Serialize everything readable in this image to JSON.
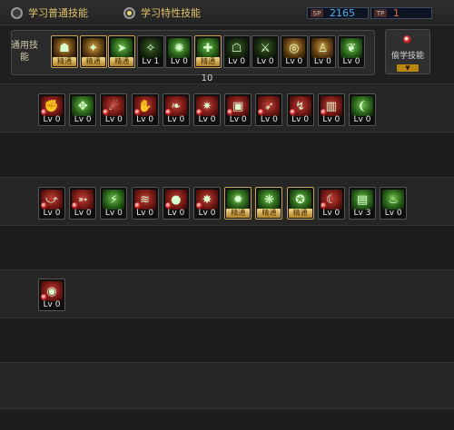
{
  "tabs": [
    {
      "label": "学习普通技能",
      "selected": false
    },
    {
      "label": "学习特性技能",
      "selected": true
    }
  ],
  "resources": [
    {
      "tag": "SP",
      "value": "2165",
      "color": "#4fb3f0"
    },
    {
      "tag": "TP",
      "value": "1",
      "color": "#e86a3a"
    }
  ],
  "common_label": "通用技能",
  "steal_label": "偷学技能",
  "master_text": "精通",
  "counter": "10",
  "common_skills": [
    {
      "level": "精通",
      "master": true,
      "tone": "gold",
      "icon": "runner-icon",
      "glyph": "☗"
    },
    {
      "level": "精通",
      "master": true,
      "tone": "gold",
      "icon": "kick-icon",
      "glyph": "✦"
    },
    {
      "level": "精通",
      "master": true,
      "tone": "green",
      "icon": "dash-icon",
      "glyph": "➤"
    },
    {
      "level": "Lv 1",
      "master": false,
      "tone": "dark",
      "icon": "wings-icon",
      "glyph": "✧"
    },
    {
      "level": "Lv 0",
      "master": false,
      "tone": "green",
      "icon": "star-burst-icon",
      "glyph": "✺"
    },
    {
      "level": "精通",
      "master": true,
      "tone": "green",
      "icon": "cross-burst-icon",
      "glyph": "✚"
    },
    {
      "level": "Lv 0",
      "master": false,
      "tone": "dark",
      "icon": "crouch-icon",
      "glyph": "☖"
    },
    {
      "level": "Lv 0",
      "master": false,
      "tone": "dark",
      "icon": "bow-icon",
      "glyph": "⚔"
    },
    {
      "level": "Lv 0",
      "master": false,
      "tone": "gold",
      "icon": "ring-icon",
      "glyph": "◎"
    },
    {
      "level": "Lv 0",
      "master": false,
      "tone": "gold",
      "icon": "figure-icon",
      "glyph": "♙"
    },
    {
      "level": "Lv 0",
      "master": false,
      "tone": "green",
      "icon": "rise-icon",
      "glyph": "❦"
    }
  ],
  "row1_skills": [
    {
      "level": "Lv 0",
      "master": false,
      "tone": "red",
      "icon": "fist-icon",
      "glyph": "✊"
    },
    {
      "level": "Lv 0",
      "master": false,
      "tone": "green",
      "icon": "spread-icon",
      "glyph": "✥"
    },
    {
      "level": "Lv 0",
      "master": false,
      "tone": "red",
      "icon": "sweep-icon",
      "glyph": "☄"
    },
    {
      "level": "Lv 0",
      "master": false,
      "tone": "red",
      "icon": "grab-icon",
      "glyph": "✋"
    },
    {
      "level": "Lv 0",
      "master": false,
      "tone": "red",
      "icon": "leaf-icon",
      "glyph": "❧"
    },
    {
      "level": "Lv 0",
      "master": false,
      "tone": "red",
      "icon": "blast-icon",
      "glyph": "✷"
    },
    {
      "level": "Lv 0",
      "master": false,
      "tone": "red",
      "icon": "box-icon",
      "glyph": "▣"
    },
    {
      "level": "Lv 0",
      "master": false,
      "tone": "red",
      "icon": "leap-icon",
      "glyph": "➶"
    },
    {
      "level": "Lv 0",
      "master": false,
      "tone": "red",
      "icon": "swirl-icon",
      "glyph": "↯"
    },
    {
      "level": "Lv 0",
      "master": false,
      "tone": "red",
      "icon": "pillar-icon",
      "glyph": "▥"
    },
    {
      "level": "Lv 0",
      "master": false,
      "tone": "green",
      "icon": "arc-icon",
      "glyph": "❨"
    }
  ],
  "row2_skills": [
    {
      "level": "Lv 0",
      "master": false,
      "tone": "red",
      "icon": "hook-icon",
      "glyph": "⤻"
    },
    {
      "level": "Lv 0",
      "master": false,
      "tone": "red",
      "icon": "thrust-icon",
      "glyph": "➳"
    },
    {
      "level": "Lv 0",
      "master": false,
      "tone": "green",
      "icon": "runner-icon",
      "glyph": "⚡"
    },
    {
      "level": "Lv 0",
      "master": false,
      "tone": "red",
      "icon": "wave-icon",
      "glyph": "≋"
    },
    {
      "level": "Lv 0",
      "master": false,
      "tone": "red",
      "icon": "orb-icon",
      "glyph": "●"
    },
    {
      "level": "Lv 0",
      "master": false,
      "tone": "red",
      "icon": "vortex-icon",
      "glyph": "✸"
    },
    {
      "level": "精通",
      "master": true,
      "tone": "green",
      "icon": "impact-icon",
      "glyph": "✹"
    },
    {
      "level": "精通",
      "master": true,
      "tone": "green",
      "icon": "quake-icon",
      "glyph": "❋"
    },
    {
      "level": "精通",
      "master": true,
      "tone": "green",
      "icon": "pound-icon",
      "glyph": "✪"
    },
    {
      "level": "Lv 0",
      "master": false,
      "tone": "red",
      "icon": "crescent-icon",
      "glyph": "☾"
    },
    {
      "level": "Lv 3",
      "master": false,
      "tone": "green",
      "icon": "slab-icon",
      "glyph": "▤"
    },
    {
      "level": "Lv 0",
      "master": false,
      "tone": "green",
      "icon": "flame-icon",
      "glyph": "♨"
    }
  ],
  "row3_skills": [
    {
      "level": "Lv 0",
      "master": false,
      "tone": "red",
      "icon": "spiral-icon",
      "glyph": "◉"
    }
  ]
}
